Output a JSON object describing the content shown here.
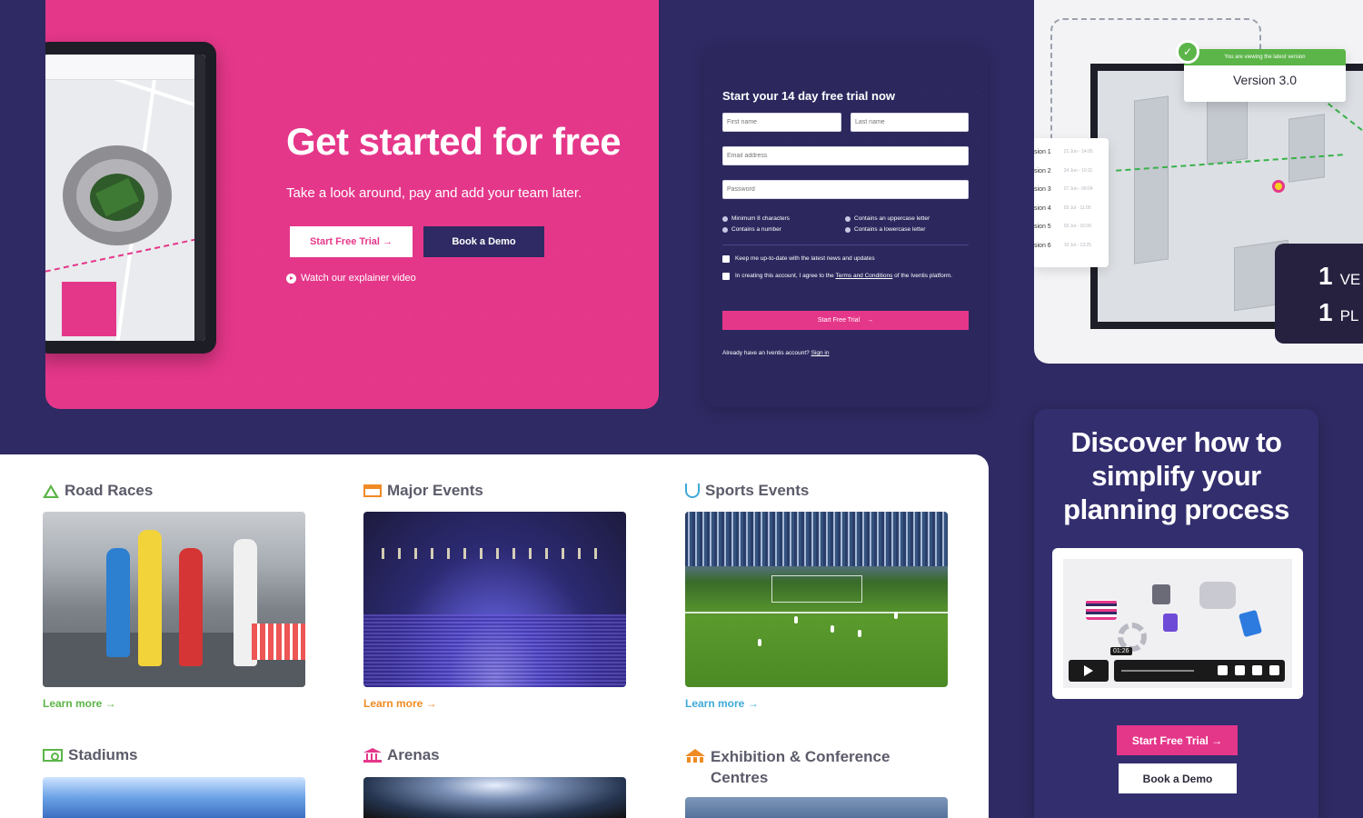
{
  "colors": {
    "brand_pink": "#e5378a",
    "navy": "#2f2a63",
    "green": "#5bb548",
    "orange": "#f08a24",
    "blue": "#3fa9d9"
  },
  "hero": {
    "title": "Get started for free",
    "subtitle": "Take a look around, pay and add your team later.",
    "primary_button": "Start Free Trial →",
    "secondary_button": "Book a Demo",
    "video_link": "Watch our explainer video"
  },
  "trial_form": {
    "title": "Start your 14 day free trial now",
    "first_name_placeholder": "First name",
    "last_name_placeholder": "Last name",
    "email_placeholder": "Email address",
    "password_placeholder": "Password",
    "requirements": [
      "Minimum 8 characters",
      "Contains an uppercase letter",
      "Contains a number",
      "Contains a lowercase letter"
    ],
    "newsletter_label": "Keep me up-to-date with the latest news and updates",
    "terms_prefix": "In creating this account, I agree to the ",
    "terms_link": "Terms and Conditions",
    "terms_suffix": " of the Iventis platform.",
    "submit": "Start Free Trial",
    "submit_arrow": "→",
    "signin_prefix": "Already have an Iventis account? ",
    "signin_link": "Sign in"
  },
  "version_card": {
    "badge_top": "You are viewing the latest version",
    "badge_title": "Version 3.0",
    "list": [
      {
        "label": "sion 1",
        "date": "21 Jun - 14:05"
      },
      {
        "label": "sion 2",
        "date": "24 Jun - 10:11"
      },
      {
        "label": "sion 3",
        "date": "27 Jun - 09:04"
      },
      {
        "label": "sion 4",
        "date": "03 Jul - 11:05"
      },
      {
        "label": "sion 5",
        "date": "03 Jul - 16:06"
      },
      {
        "label": "sion 6",
        "date": "10 Jul - 13:25"
      }
    ],
    "counter_1": "1",
    "counter_1_label": "VE",
    "counter_2": "1",
    "counter_2_label": "PL"
  },
  "use_cases": [
    {
      "title": "Road Races",
      "link": "Learn more →",
      "color": "#5bb548"
    },
    {
      "title": "Major Events",
      "link": "Learn more →",
      "color": "#f08a24"
    },
    {
      "title": "Sports Events",
      "link": "Learn more →",
      "color": "#3fa9d9"
    },
    {
      "title": "Stadiums",
      "color": "#5bb548"
    },
    {
      "title": "Arenas",
      "color": "#e5378a"
    },
    {
      "title": "Exhibition & Conference Centres",
      "color": "#f08a24"
    }
  ],
  "discover": {
    "title_lines": [
      "Discover how to",
      "simplify your",
      "planning process"
    ],
    "video_time": "01:26",
    "primary_button": "Start Free Trial →",
    "secondary_button": "Book a Demo"
  }
}
